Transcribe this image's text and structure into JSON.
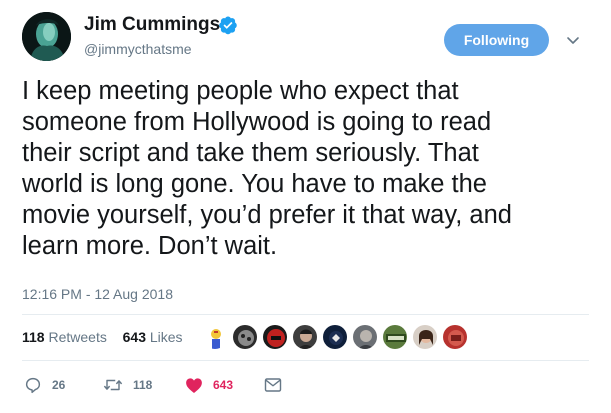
{
  "author": {
    "display_name": "Jim Cummings",
    "handle": "@jimmycthatsme",
    "verified_icon": "verified-badge-icon"
  },
  "follow_button": {
    "label": "Following"
  },
  "tweet": {
    "text": "I keep meeting people who expect that\nsomeone from Hollywood is going to read\ntheir script and take them seriously. That\nworld is long gone. You have to make the\nmovie yourself, you’d prefer it that way, and\nlearn more. Don’t wait.",
    "timestamp": "12:16 PM - 12 Aug 2018"
  },
  "stats": {
    "retweets_count": "118",
    "retweets_label": "Retweets",
    "likes_count": "643",
    "likes_label": "Likes"
  },
  "likers": [
    "avatar-1",
    "avatar-2",
    "avatar-3",
    "avatar-4",
    "avatar-5",
    "avatar-6",
    "avatar-7",
    "avatar-8",
    "avatar-9"
  ],
  "actions": {
    "reply_count": "26",
    "retweet_count": "118",
    "like_count": "643"
  },
  "colors": {
    "accent": "#60a5e8",
    "verified": "#1da1f2",
    "like": "#e0245e",
    "retweet": "#17bf63",
    "secondary_text": "#657786"
  }
}
